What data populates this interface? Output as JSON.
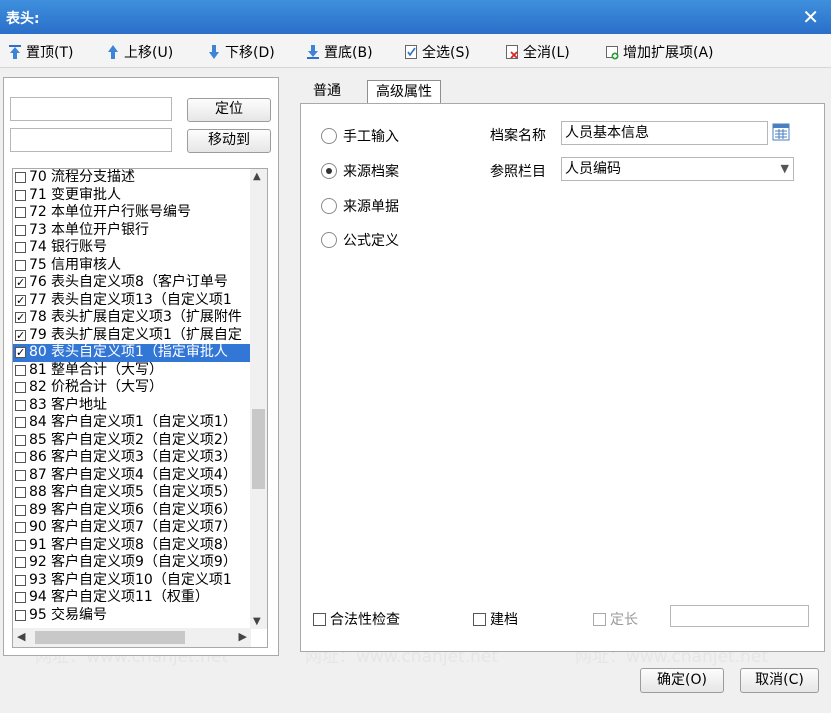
{
  "window": {
    "title": "表头:",
    "close_glyph": "✕"
  },
  "toolbar": {
    "top": "置顶(T)",
    "up": "上移(U)",
    "down": "下移(D)",
    "bottom": "置底(B)",
    "select_all": "全选(S)",
    "deselect_all": "全消(L)",
    "add_ext": "增加扩展项(A)"
  },
  "left": {
    "locate_button": "定位",
    "move_to_button": "移动到",
    "search_value": "",
    "move_value": "",
    "items": [
      {
        "num": "70",
        "label": "流程分支描述",
        "checked": false
      },
      {
        "num": "71",
        "label": "变更审批人",
        "checked": false
      },
      {
        "num": "72",
        "label": "本单位开户行账号编号",
        "checked": false
      },
      {
        "num": "73",
        "label": "本单位开户银行",
        "checked": false
      },
      {
        "num": "74",
        "label": "银行账号",
        "checked": false
      },
      {
        "num": "75",
        "label": "信用审核人",
        "checked": false
      },
      {
        "num": "76",
        "label": "表头自定义项8（客户订单号",
        "checked": true
      },
      {
        "num": "77",
        "label": "表头自定义项13（自定义项1",
        "checked": true
      },
      {
        "num": "78",
        "label": "表头扩展自定义项3（扩展附件",
        "checked": true
      },
      {
        "num": "79",
        "label": "表头扩展自定义项1（扩展自定",
        "checked": true
      },
      {
        "num": "80",
        "label": "表头自定义项1（指定审批人",
        "checked": true,
        "selected": true
      },
      {
        "num": "81",
        "label": "整单合计（大写）",
        "checked": false
      },
      {
        "num": "82",
        "label": "价税合计（大写）",
        "checked": false
      },
      {
        "num": "83",
        "label": "客户地址",
        "checked": false
      },
      {
        "num": "84",
        "label": "客户自定义项1（自定义项1）",
        "checked": false
      },
      {
        "num": "85",
        "label": "客户自定义项2（自定义项2）",
        "checked": false
      },
      {
        "num": "86",
        "label": "客户自定义项3（自定义项3）",
        "checked": false
      },
      {
        "num": "87",
        "label": "客户自定义项4（自定义项4）",
        "checked": false
      },
      {
        "num": "88",
        "label": "客户自定义项5（自定义项5）",
        "checked": false
      },
      {
        "num": "89",
        "label": "客户自定义项6（自定义项6）",
        "checked": false
      },
      {
        "num": "90",
        "label": "客户自定义项7（自定义项7）",
        "checked": false
      },
      {
        "num": "91",
        "label": "客户自定义项8（自定义项8）",
        "checked": false
      },
      {
        "num": "92",
        "label": "客户自定义项9（自定义项9）",
        "checked": false
      },
      {
        "num": "93",
        "label": "客户自定义项10（自定义项1",
        "checked": false
      },
      {
        "num": "94",
        "label": "客户自定义项11（权重）",
        "checked": false
      },
      {
        "num": "95",
        "label": "交易编号",
        "checked": false
      }
    ]
  },
  "tabs": {
    "normal": "普通",
    "advanced": "高级属性"
  },
  "advanced": {
    "radio_manual": "手工输入",
    "radio_source_archive": "来源档案",
    "radio_source_doc": "来源单据",
    "radio_formula": "公式定义",
    "archive_name_label": "档案名称",
    "archive_name_value": "人员基本信息",
    "ref_column_label": "参照栏目",
    "ref_column_value": "人员编码",
    "check_validity": "合法性检查",
    "check_archive": "建档",
    "check_fixed_length": "定长",
    "fixed_length_value": ""
  },
  "footer": {
    "ok": "确定(O)",
    "cancel": "取消(C)"
  },
  "watermark": {
    "phone": "电话：400-665-0028",
    "site": "网址：www.chanjet.net"
  },
  "colors": {
    "titlebar": "#2a6fc9",
    "selection": "#3377d6"
  }
}
